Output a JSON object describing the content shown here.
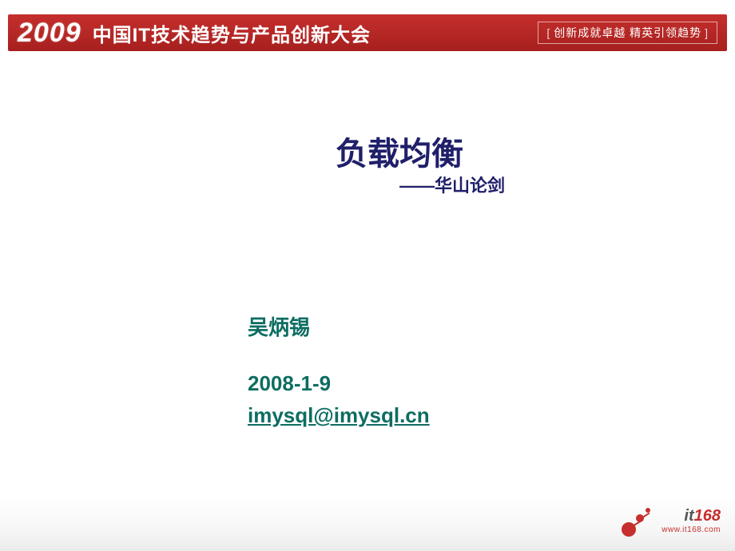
{
  "banner": {
    "year": "2009",
    "headline": "中国IT技术趋势与产品创新大会",
    "slogan": "创新成就卓越 精英引领趋势"
  },
  "slide": {
    "title": "负载均衡",
    "subtitle": "——华山论剑",
    "author": "吴炳锡",
    "date": "2008-1-9",
    "email": "imysql@imysql.cn"
  },
  "footer": {
    "brand_left": "it",
    "brand_right": "168",
    "url": "www.it168.com"
  }
}
